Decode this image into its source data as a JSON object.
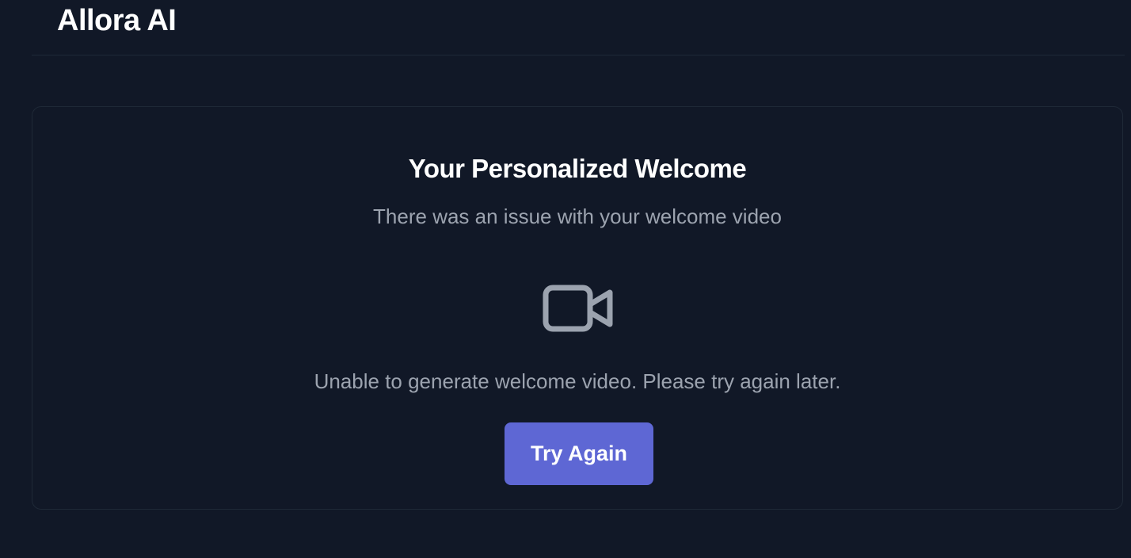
{
  "header": {
    "brand": "Allora AI"
  },
  "card": {
    "title": "Your Personalized Welcome",
    "subtitle": "There was an issue with your welcome video",
    "icon": "video-camera-icon",
    "error_message": "Unable to generate welcome video. Please try again later.",
    "retry_label": "Try Again"
  },
  "colors": {
    "background": "#111827",
    "border": "#1f2937",
    "muted_text": "#9ca3af",
    "accent": "#5e67d4"
  }
}
